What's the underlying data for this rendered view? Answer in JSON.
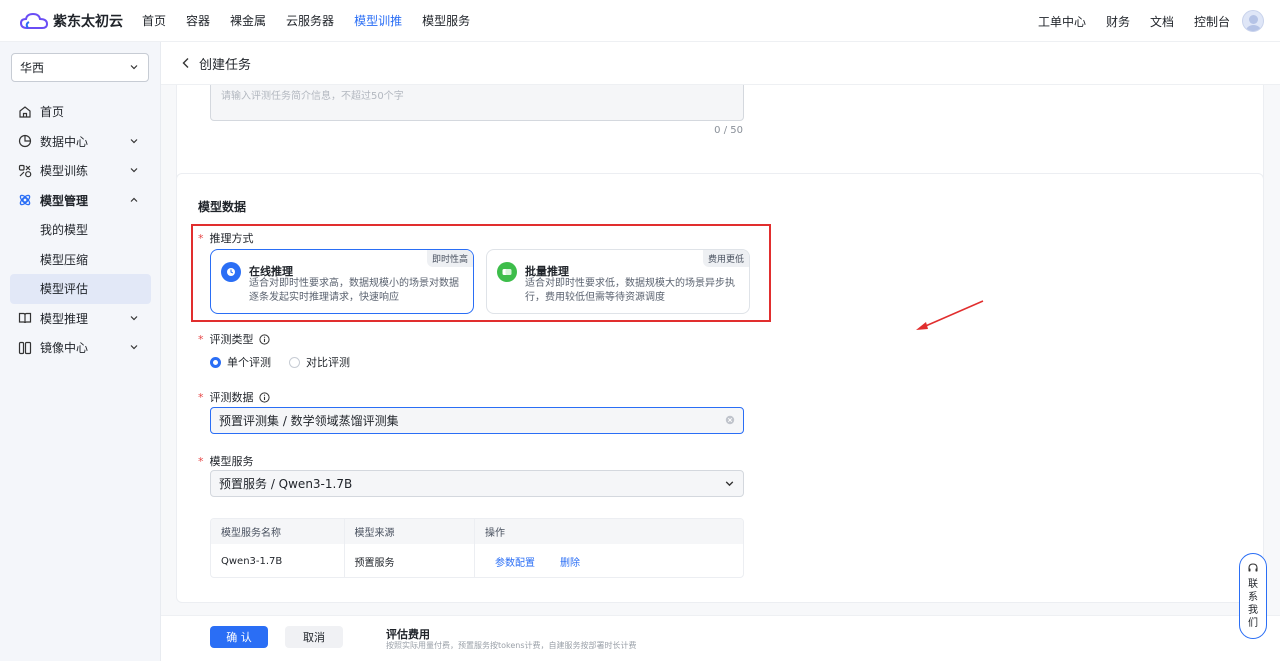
{
  "brand": {
    "name": "紫东太初云"
  },
  "topnav": {
    "items": [
      "首页",
      "容器",
      "裸金属",
      "云服务器",
      "模型训推",
      "模型服务"
    ],
    "active_index": 4,
    "right_items": [
      "工单中心",
      "财务",
      "文档",
      "控制台"
    ]
  },
  "sidebar": {
    "region": "华西",
    "menu": {
      "home": "首页",
      "data_center": "数据中心",
      "model_training": "模型训练",
      "model_management": "模型管理",
      "my_models": "我的模型",
      "model_compression": "模型压缩",
      "model_evaluation": "模型评估",
      "model_inference": "模型推理",
      "image_center": "镜像中心"
    }
  },
  "header": {
    "title": "创建任务"
  },
  "desc_field": {
    "placeholder": "请输入评测任务简介信息，不超过50个字",
    "counter": "0 / 50"
  },
  "model_data": {
    "section_title": "模型数据",
    "inference_label": "推理方式",
    "online": {
      "title": "在线推理",
      "desc": "适合对即时性要求高，数据规模小的场景对数据逐条发起实时推理请求，快速响应",
      "tag": "即时性高"
    },
    "batch": {
      "title": "批量推理",
      "desc": "适合对即时性要求低，数据规模大的场景异步执行，费用较低但需等待资源调度",
      "tag": "费用更低"
    },
    "eval_type_label": "评测类型",
    "eval_type_options": [
      "单个评测",
      "对比评测"
    ],
    "eval_data_label": "评测数据",
    "eval_data_value": "预置评测集 / 数学领域蒸馏评测集",
    "service_label": "模型服务",
    "service_value": "预置服务 / Qwen3-1.7B",
    "table": {
      "headers": [
        "模型服务名称",
        "模型来源",
        "操作"
      ],
      "rows": [
        {
          "name": "Qwen3-1.7B",
          "source": "预置服务",
          "actions": [
            "参数配置",
            "删除"
          ]
        }
      ]
    }
  },
  "footer": {
    "confirm": "确 认",
    "cancel": "取消",
    "fee_title": "评估费用",
    "fee_desc": "按照实际用量付费，预置服务按tokens计费，自建服务按部署时长计费"
  },
  "contact": {
    "label": "联系我们"
  },
  "colors": {
    "accent": "#2a6ef5",
    "annotation_red": "#e12e2e"
  }
}
